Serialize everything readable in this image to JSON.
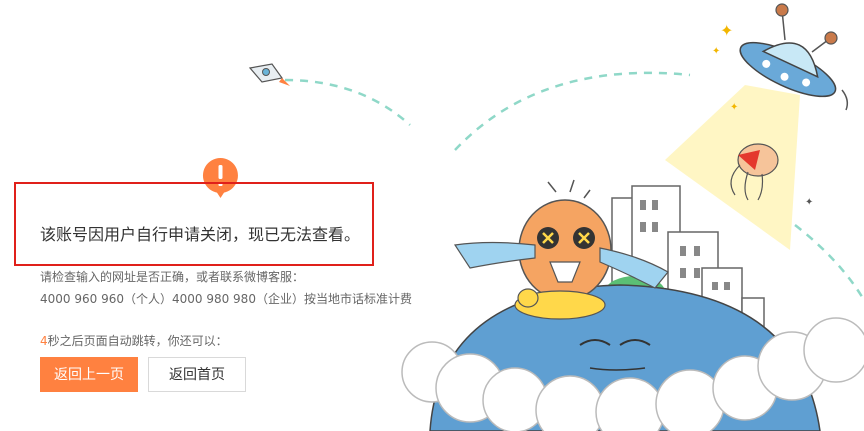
{
  "message": {
    "main": "该账号因用户自行申请关闭，现已无法查看。",
    "hint_line1": "请检查输入的网址是否正确，或者联系微博客服：",
    "hint_line2": "4000 960 960（个人）4000 980 980（企业）按当地市话标准计费"
  },
  "redirect": {
    "seconds": "4",
    "text": "秒之后页面自动跳转，你还可以："
  },
  "buttons": {
    "back_label": "返回上一页",
    "home_label": "返回首页"
  },
  "colors": {
    "accent": "#ff8140",
    "highlight_border": "#e0201a",
    "text_main": "#333333",
    "text_sub": "#666666"
  },
  "icons": {
    "alert": "exclamation-badge-icon"
  }
}
